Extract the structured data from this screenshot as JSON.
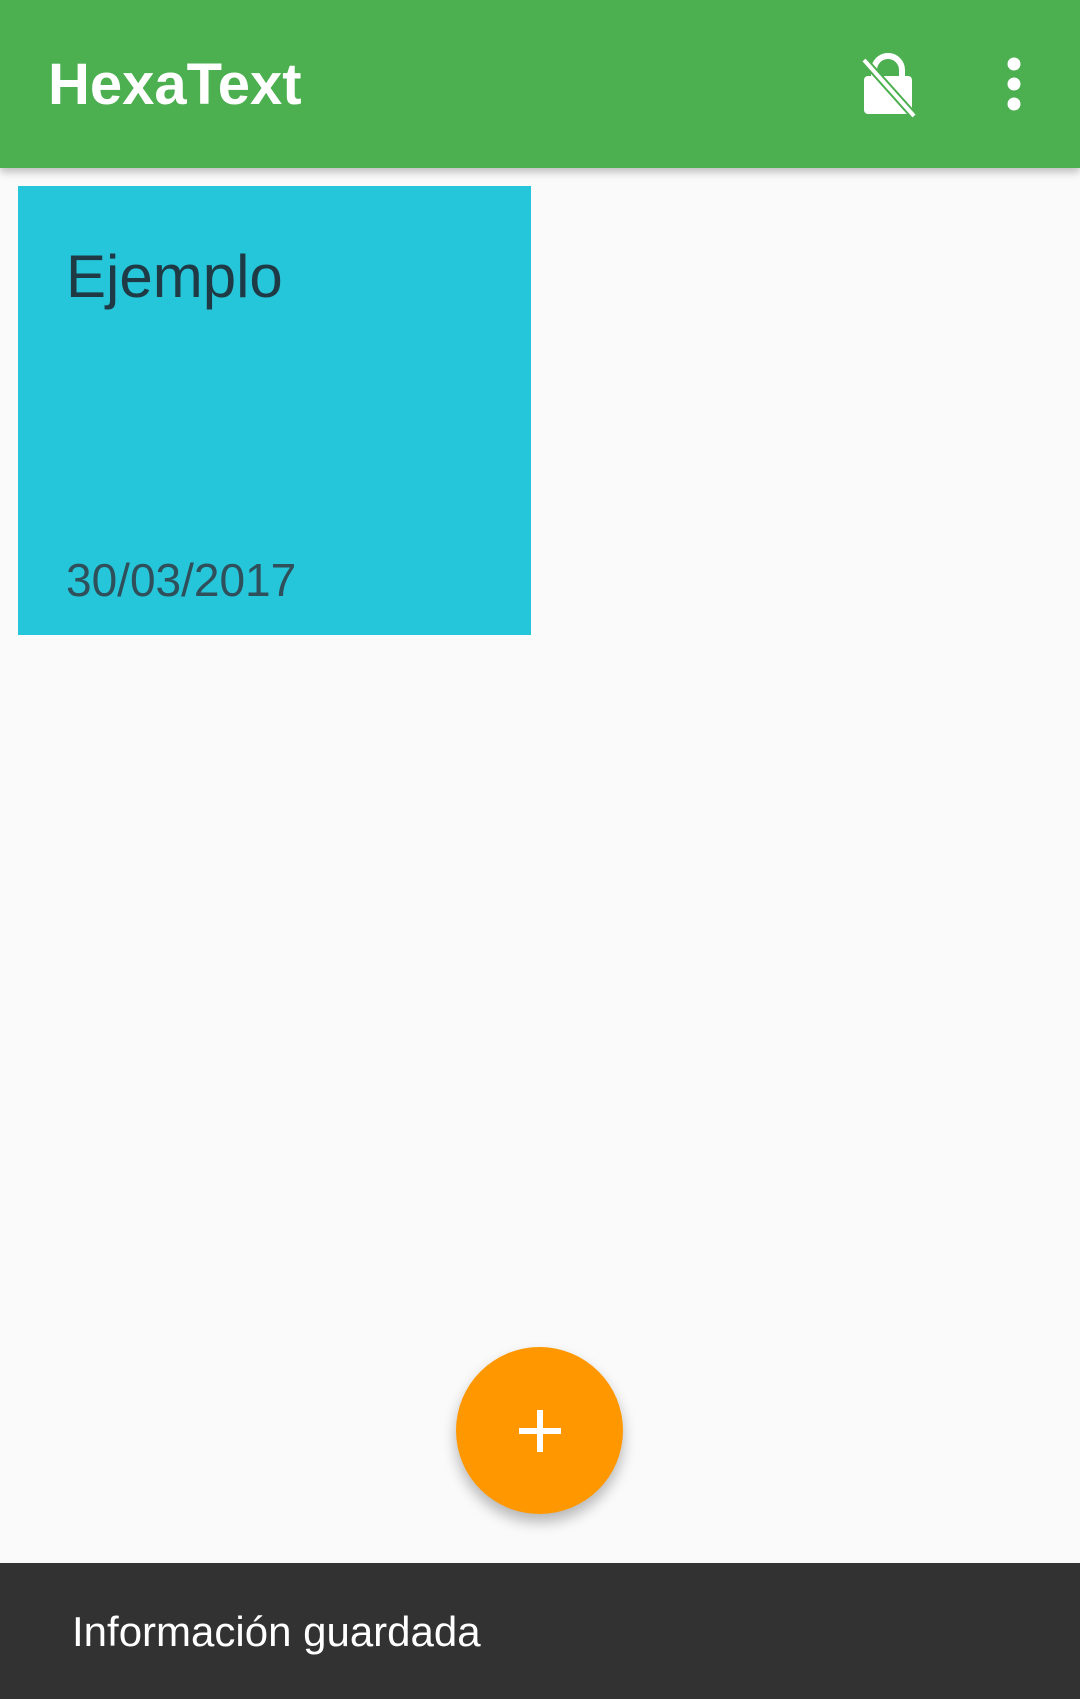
{
  "toolbar": {
    "title": "HexaText",
    "lock_icon": "no-encryption-icon",
    "more_icon": "more-vert-icon",
    "color": "#4caf50"
  },
  "notes": [
    {
      "title": "Ejemplo",
      "date": "30/03/2017",
      "color": "#26c6da"
    }
  ],
  "fab": {
    "icon": "plus-icon",
    "color": "#ff9800"
  },
  "snackbar": {
    "message": "Información guardada"
  }
}
